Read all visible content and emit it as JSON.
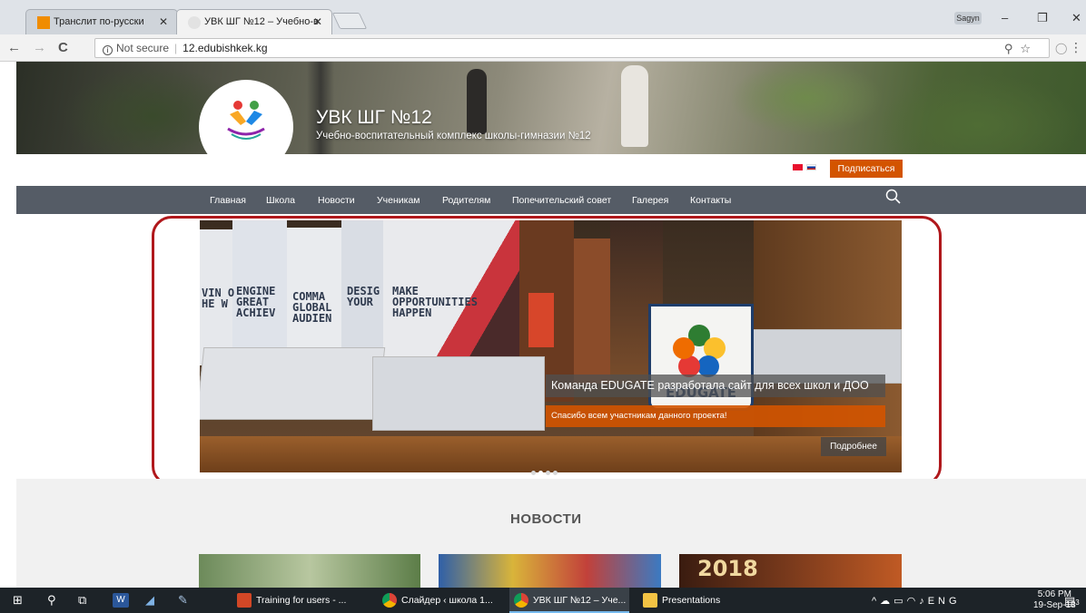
{
  "browser": {
    "tabs": [
      {
        "label": "Транслит по-русски",
        "favicon_color": "#f08c00",
        "active": false
      },
      {
        "label": "УВК ШГ №12 – Учебно-в",
        "favicon_color": "#d9d9d9",
        "active": true
      }
    ],
    "close_glyph": "✕",
    "profile_label": "Sagyn",
    "window_controls": {
      "minimize": "–",
      "restore": "❐",
      "close": "✕"
    },
    "nav": {
      "back": "←",
      "forward": "→",
      "reload": "C"
    },
    "address": {
      "security_label": "Not secure",
      "url": "12.edubishkek.kg"
    },
    "omnibox_icons": [
      "zoom-icon",
      "star-icon",
      "extension-icon",
      "menu-icon"
    ]
  },
  "site": {
    "title": "УВК ШГ №12",
    "subtitle": "Учебно-воспитательный комплекс школы-гимназии №12",
    "languages": [
      {
        "code": "ky",
        "colors": [
          "#e8112d",
          "#f7d117"
        ]
      },
      {
        "code": "ru",
        "colors": [
          "#ffffff",
          "#0039a6",
          "#d52b1e"
        ]
      }
    ],
    "subscribe_label": "Подписаться",
    "accent": "#d35400",
    "nav_bg": "#555c66",
    "menu": [
      {
        "label": "Главная"
      },
      {
        "label": "Школа"
      },
      {
        "label": "Новости"
      },
      {
        "label": "Ученикам"
      },
      {
        "label": "Родителям"
      },
      {
        "label": "Попечительский совет"
      },
      {
        "label": "Галерея"
      },
      {
        "label": "Контакты"
      }
    ]
  },
  "slider": {
    "book_lines": [
      {
        "lines": [
          "VIN O",
          "HE W"
        ]
      },
      {
        "lines": [
          "ENGINE",
          "GREAT",
          "ACHIEV"
        ]
      },
      {
        "lines": [
          "COMMA",
          "GLOBAL",
          "AUDIEN"
        ]
      },
      {
        "lines": [
          "DESIG",
          "YOUR"
        ]
      },
      {
        "lines": [
          "MAKE",
          "OPPORTUNITIES",
          "HAPPEN"
        ]
      }
    ],
    "mug_text": "EDUGATE",
    "caption_title": "Команда EDUGATE разработала сайт для всех школ и ДОО",
    "caption_text": "Спасибо всем участникам данного проекта!",
    "more_label": "Подробнее",
    "dots_total": 4,
    "active_dot": 2,
    "highlight_color": "#b0181c"
  },
  "news": {
    "heading": "НОВОСТИ",
    "thumb_text": "2018"
  },
  "taskbar": {
    "apps": [
      {
        "label": "Training for users - ...",
        "icon_color": "#d24726",
        "active": false
      },
      {
        "label": "Слайдер ‹ школа 1...",
        "icon_color": "#e8a317",
        "active": false
      },
      {
        "label": "УВК ШГ №12 – Уче...",
        "icon_color": "#e8a317",
        "active": true
      },
      {
        "label": "Presentations",
        "icon_color": "#f3c344",
        "active": false
      }
    ],
    "tray_lang": "ENG",
    "time": "5:06 PM",
    "date": "19-Sep-18",
    "notification_count": "3"
  }
}
